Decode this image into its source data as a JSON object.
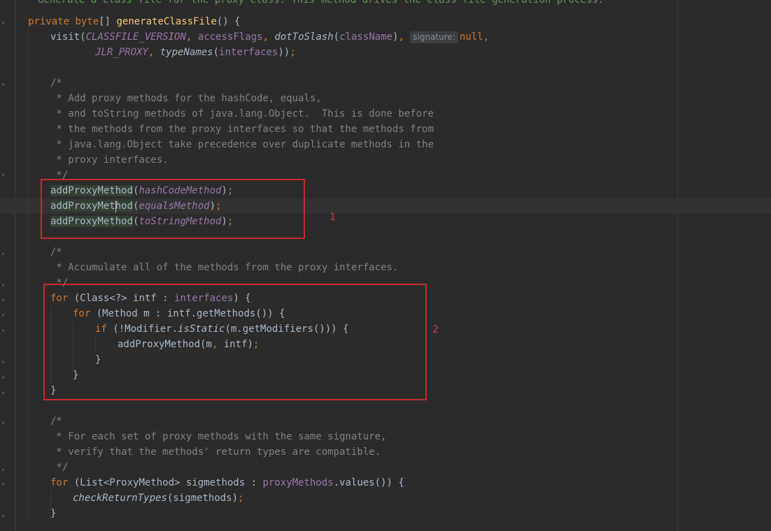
{
  "editor": {
    "language": "java",
    "doc_comment_top": "Generate a class file for the proxy class. This method drives the class file generation process.",
    "method_signature": {
      "modifier": "private",
      "return_type": "byte",
      "brackets": "[]",
      "name": "generateClassFile",
      "parens": "() {"
    },
    "visit_call": {
      "fn": "visit",
      "arg1": "CLASSFILE_VERSION",
      "arg2": "accessFlags",
      "arg3_fn": "dotToSlash",
      "arg3_param": "className",
      "hint": "signature:",
      "arg4": "null",
      "arg5": "JLR_PROXY",
      "arg6_fn": "typeNames",
      "arg6_param": "interfaces"
    },
    "comment1": [
      "/*",
      " * Add proxy methods for the hashCode, equals,",
      " * and toString methods of java.lang.Object.  This is done before",
      " * the methods from the proxy interfaces so that the methods from",
      " * java.lang.Object take precedence over duplicate methods in the",
      " * proxy interfaces.",
      " */"
    ],
    "add_calls": [
      {
        "fn": "addProxyMethod",
        "arg": "hashCodeMethod"
      },
      {
        "fn_pre": "addProxyMet",
        "fn_post": "hod",
        "arg": "equalsMethod"
      },
      {
        "fn": "addProxyMethod",
        "arg": "toStringMethod"
      }
    ],
    "comment2": [
      "/*",
      " * Accumulate all of the methods from the proxy interfaces.",
      " */"
    ],
    "loop": {
      "for_kw": "for",
      "outer_head": " (Class<?> intf : ",
      "outer_field": "interfaces",
      "outer_tail": ") {",
      "inner_head": " (Method m : intf.getMethods()) {",
      "if_kw": "if",
      "if_pre": " (!Modifier.",
      "if_static": "isStatic",
      "if_post": "(m.getModifiers())) {",
      "call": "addProxyMethod(m",
      "call_tail": " intf)",
      "close": "}"
    },
    "comment3": [
      "/*",
      " * For each set of proxy methods with the same signature,",
      " * verify that the methods' return types are compatible.",
      " */"
    ],
    "loop2": {
      "head": " (List<ProxyMethod> sigmethods : ",
      "field": "proxyMethods",
      "tail": ".values()) {",
      "call": "checkReturnTypes",
      "call_arg": "(sigmethods)",
      "close": "}"
    }
  },
  "annotations": [
    {
      "label": "1"
    },
    {
      "label": "2"
    }
  ],
  "colors": {
    "background": "#2b2b2b",
    "keyword": "#cc7832",
    "method_decl": "#ffc66d",
    "field": "#9876aa",
    "comment": "#808080",
    "annotation_box": "#c8282d"
  }
}
